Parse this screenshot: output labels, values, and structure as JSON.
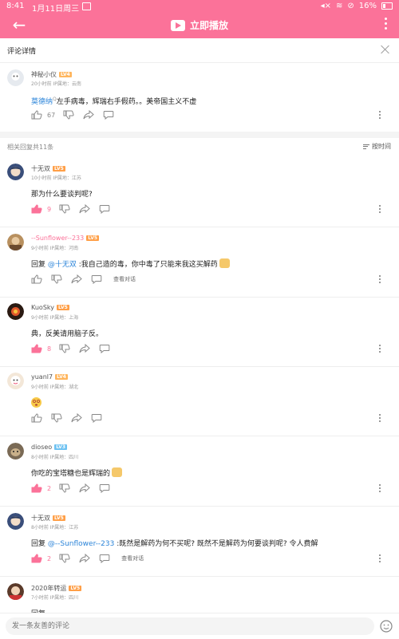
{
  "status_bar": {
    "time": "8:41",
    "date": "1月11日周三",
    "battery": "16%"
  },
  "app_bar": {
    "title": "立即播放"
  },
  "sub_header": {
    "label": "评论详情"
  },
  "main_comment": {
    "username": "神秘小仪",
    "level": "LV4",
    "meta": "20小时前  IP属地：云南",
    "mention": "莫德纳",
    "text": "左手病毒，辉瑞右手假药。。美帝国主义不虚",
    "likes": "67"
  },
  "reply_header": {
    "count_text": "相关回复共11条",
    "sort_label": "按时间"
  },
  "replies": [
    {
      "username": "十无双",
      "level": "LV5",
      "meta": "10小时前  IP属地：江苏",
      "prefix": "",
      "mention": "",
      "text": "那为什么要谈判呢?",
      "likes": "9",
      "liked": true,
      "view_conv": ""
    },
    {
      "username": "--Sunflower--233",
      "level": "LV5",
      "meta": "9小时前  IP属地：河南",
      "prefix": "回复 ",
      "mention": "@十无双",
      "text": " :我自己造的毒，你中毒了只能来我这买解药",
      "likes": "",
      "liked": false,
      "view_conv": "查看对话"
    },
    {
      "username": "KuoSky",
      "level": "LV5",
      "meta": "9小时前  IP属地：上海",
      "prefix": "",
      "mention": "",
      "text": "典，反美请用脑子反。",
      "likes": "8",
      "liked": true,
      "view_conv": ""
    },
    {
      "username": "yuanl7",
      "level": "LV4",
      "meta": "9小时前  IP属地：湖北",
      "prefix": "",
      "mention": "",
      "text": "",
      "likes": "",
      "liked": false,
      "view_conv": ""
    },
    {
      "username": "dioseo",
      "level": "LV3",
      "meta": "8小时前  IP属地：四川",
      "prefix": "",
      "mention": "",
      "text": "你吃的宝塔糖也是辉瑞的",
      "likes": "2",
      "liked": true,
      "view_conv": ""
    },
    {
      "username": "十无双",
      "level": "LV5",
      "meta": "8小时前  IP属地：江苏",
      "prefix": "回复 ",
      "mention": "@--Sunflower--233",
      "text": " :既然是解药为何不买呢? 既然不是解药为何要谈判呢? 令人费解",
      "likes": "2",
      "liked": true,
      "view_conv": "查看对话"
    },
    {
      "username": "2020年转运",
      "level": "LV5",
      "meta": "7小时前  IP属地：四川",
      "prefix": "回复 ",
      "mention": "",
      "text": "",
      "likes": "",
      "liked": false,
      "view_conv": ""
    }
  ],
  "bottom_bar": {
    "placeholder": "发一条友善的评论"
  },
  "colors": {
    "brand": "#fb7299",
    "mention": "#2b84d9",
    "level5": "#ff9f47",
    "level3": "#6ec2f2"
  }
}
